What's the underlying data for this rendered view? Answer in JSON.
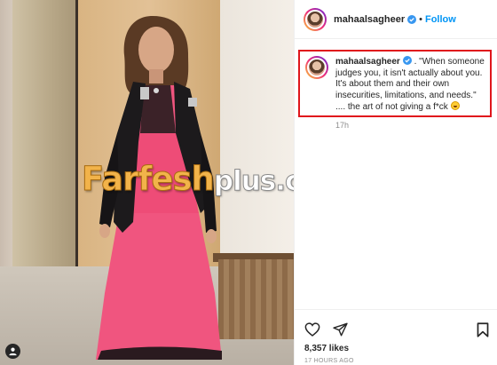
{
  "header": {
    "username": "mahaalsagheer",
    "separator": "•",
    "follow_label": "Follow"
  },
  "caption": {
    "username": "mahaalsagheer",
    "text": " . \"When someone judges you, it isn't actually about you. It's about them and their own insecurities, limitations, and needs.\" .... the art of not giving a f*ck "
  },
  "post": {
    "time_ago": "17h",
    "likes": "8,357 likes",
    "posted_ago": "17 HOURS AGO"
  },
  "watermark": {
    "main": "Farfesh",
    "sub": "plus.com"
  },
  "icons": {
    "verified": "verified-badge-icon",
    "heart": "heart-icon",
    "share": "paper-plane-icon",
    "bookmark": "bookmark-icon",
    "tag": "user-tag-icon",
    "caption_emoji": "grinning-face-emoji"
  },
  "colors": {
    "follow": "#0095f6",
    "verified": "#3897f0",
    "highlight_border": "#e0161c",
    "dress": "#f0557f"
  }
}
